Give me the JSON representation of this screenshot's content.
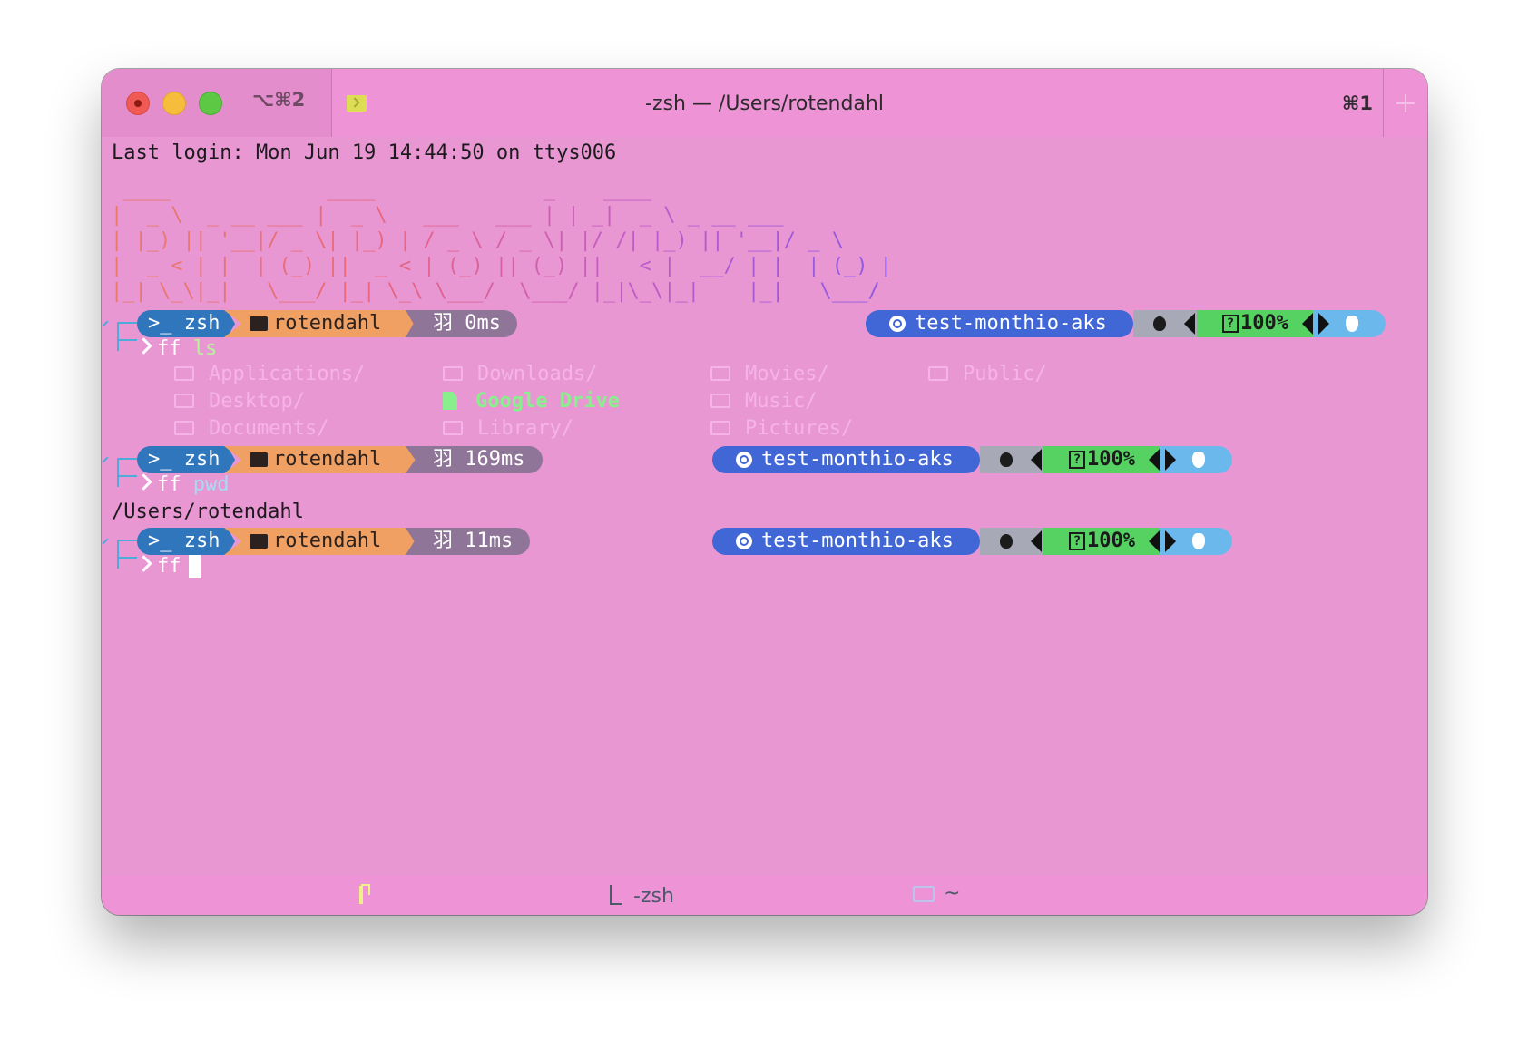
{
  "window": {
    "title": "-zsh — /Users/rotendahl",
    "tab_shortcut": "⌥⌘2",
    "window_shortcut": "⌘1"
  },
  "terminal": {
    "last_login": "Last login: Mon Jun 19 14:44:50 on ttys006",
    "banner": " ____             ____              _    ____\n|  _ \\  _ __ ___ |  _ \\   ___   ___ | | _|  _ \\ _ __ ___\n| |_) || '__|/ _ \\| |_) | / _ \\ / _ \\| |/ /| |_) || '__|/ _ \\\n|  _ < | |  | (_) ||  _ < | (_) || (_) ||   < |  __/ | |  | (_) |\n|_| \\_\\|_|   \\___/ |_| \\_\\ \\___/  \\___/ |_|\\_\\|_|    |_|   \\___/",
    "prompts": [
      {
        "shell": ">_ zsh",
        "dir": "rotendahl",
        "time": "羽 0ms",
        "context": "test-monthio-aks",
        "battery": "100%",
        "command": "ls"
      },
      {
        "shell": ">_ zsh",
        "dir": "rotendahl",
        "time": "羽 169ms",
        "context": "test-monthio-aks",
        "battery": "100%",
        "command": "pwd"
      },
      {
        "shell": ">_ zsh",
        "dir": "rotendahl",
        "time": "羽 11ms",
        "context": "test-monthio-aks",
        "battery": "100%",
        "command": ""
      }
    ],
    "prefix": "ff",
    "ls_output": [
      "Applications/",
      "Downloads/",
      "Movies/",
      "Public/",
      "Desktop/",
      "Google Drive",
      "Music/",
      "Documents/",
      "Library/",
      "Pictures/"
    ],
    "pwd_output": "/Users/rotendahl"
  },
  "statusbar": {
    "process": "-zsh",
    "directory": "~"
  },
  "colors": {
    "background": "#e897d3",
    "zsh_segment": "#2f76bd",
    "dir_segment": "#f1a063",
    "time_segment": "#8f7597",
    "k8s_segment": "#4167d6",
    "battery_segment": "#56d263",
    "google_drive": "#89ef8d"
  }
}
